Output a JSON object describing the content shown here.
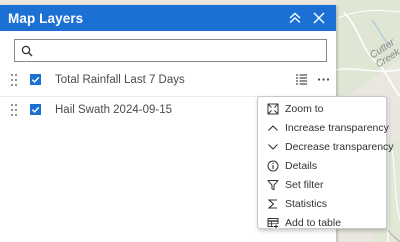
{
  "map": {
    "place_label": "Cutter Creek"
  },
  "panel": {
    "title": "Map Layers",
    "header_color": "#1c6fd3",
    "search": {
      "value": "",
      "placeholder": ""
    }
  },
  "layers": [
    {
      "label": "Total Rainfall Last 7 Days",
      "checked": true
    },
    {
      "label": "Hail Swath 2024-09-15",
      "checked": true
    }
  ],
  "context_menu": {
    "items": [
      {
        "label": "Zoom to",
        "icon": "zoom-to-icon"
      },
      {
        "label": "Increase transparency",
        "icon": "chevron-up-icon"
      },
      {
        "label": "Decrease transparency",
        "icon": "chevron-down-icon"
      },
      {
        "label": "Details",
        "icon": "info-icon"
      },
      {
        "label": "Set filter",
        "icon": "filter-icon"
      },
      {
        "label": "Statistics",
        "icon": "sigma-icon"
      },
      {
        "label": "Add to table",
        "icon": "table-add-icon"
      }
    ]
  }
}
